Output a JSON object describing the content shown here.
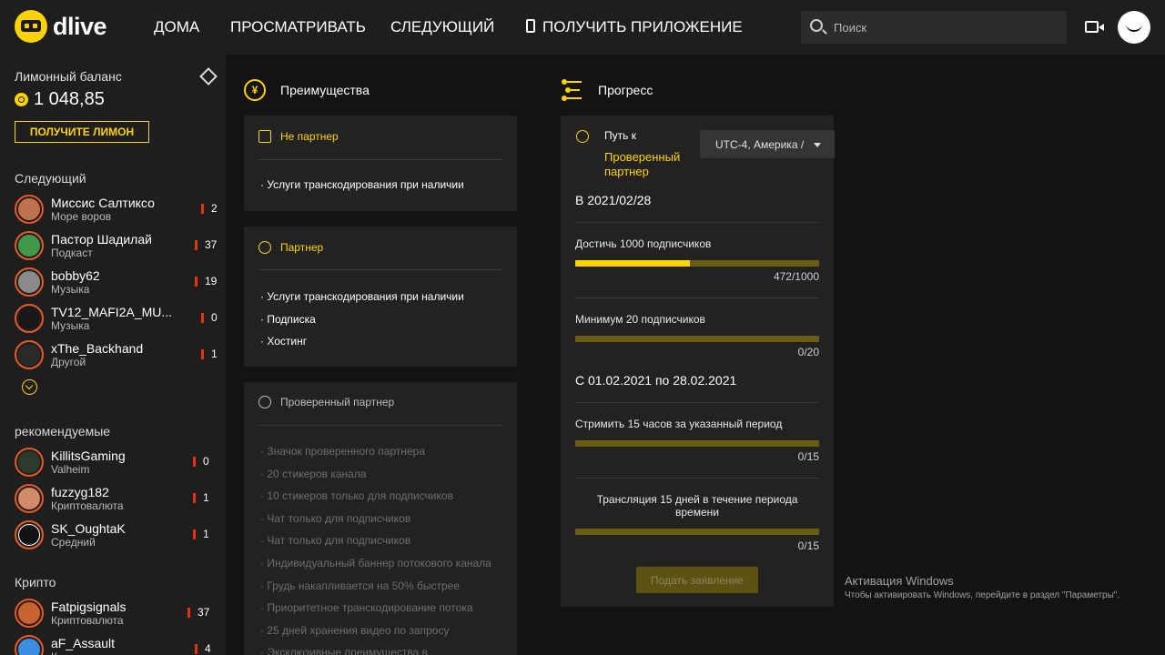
{
  "app": {
    "logo_text": "dlive"
  },
  "nav": {
    "home": "ДОМА",
    "browse": "ПРОСМАТРИВАТЬ",
    "following": "СЛЕДУЮЩИЙ",
    "get_app": "ПОЛУЧИТЬ ПРИЛОЖЕНИЕ"
  },
  "search": {
    "placeholder": "Поиск"
  },
  "sidebar": {
    "balance_title": "Лимонный баланс",
    "balance_value": "1 048,85",
    "get_lemon_label": "ПОЛУЧИТЕ ЛИМОН",
    "following_title": "Следующий",
    "following": [
      {
        "name": "Миссис Салтиксо",
        "category": "Море воров",
        "viewers": "2"
      },
      {
        "name": "Пастор Шадилай",
        "category": "Подкаст",
        "viewers": "37"
      },
      {
        "name": "bobby62",
        "category": "Музыка",
        "viewers": "19"
      },
      {
        "name": "TV12_MAFI2A_MU...",
        "category": "Музыка",
        "viewers": "0"
      },
      {
        "name": "xThe_Backhand",
        "category": "Другой",
        "viewers": "1"
      }
    ],
    "recommended_title": "рекомендуемые",
    "recommended": [
      {
        "name": "KillitsGaming",
        "category": "Valheim",
        "viewers": "0"
      },
      {
        "name": "fuzzyg182",
        "category": "Криптовалюта",
        "viewers": "1"
      },
      {
        "name": "SK_OughtaK",
        "category": "Средний",
        "viewers": "1"
      }
    ],
    "crypto_title": "Крипто",
    "crypto": [
      {
        "name": "Fatpigsignals",
        "category": "Криптовалюта",
        "viewers": "37"
      },
      {
        "name": "aF_Assault",
        "category": "К",
        "viewers": "4"
      }
    ]
  },
  "benefits": {
    "header": "Преимущества",
    "non_partner": {
      "title": "Не партнер",
      "items": [
        "· Услуги транскодирования при наличии"
      ]
    },
    "partner": {
      "title": "Партнер",
      "items": [
        "· Услуги транскодирования при наличии",
        "· Подписка",
        "· Хостинг"
      ]
    },
    "verified": {
      "title": "Проверенный партнер",
      "items": [
        "· Значок проверенного партнера",
        "· 20 стикеров канала",
        "· 10 стикеров только для подписчиков",
        "· Чат только для подписчиков",
        "· Чат только для подписчиков",
        "· Индивидуальный баннер потокового канала",
        "· Грудь накапливается на 50% быстрее",
        "· Приоритетное транскодирование потока",
        "· 25 дней хранения видео по запросу",
        "· Эксклюзивные преимущества в"
      ]
    }
  },
  "progress": {
    "header": "Прогресс",
    "path_to": "Путь к",
    "target_line1": "Проверенный",
    "target_line2": "партнер",
    "timezone": "UTC-4, Америка /",
    "as_of": "В 2021/02/28",
    "req1_label": "Достичь 1000 подписчиков",
    "req1_count": "472/1000",
    "req1_fraction": 0.472,
    "req2_label": "Минимум 20 подписчиков",
    "req2_count": "0/20",
    "req2_fraction": 0,
    "period": "С 01.02.2021 по 28.02.2021",
    "req3_label": "Стримить 15 часов за указанный период",
    "req3_count": "0/15",
    "req3_fraction": 0,
    "req4_label_line1": "Трансляция 15 дней в течение периода",
    "req4_label_line2": "времени",
    "req4_count": "0/15",
    "req4_fraction": 0,
    "apply_label": "Подать заявление"
  },
  "windows_activation": {
    "title": "Активация Windows",
    "subtitle": "Чтобы активировать Windows, перейдите в раздел \"Параметры\"."
  },
  "colors": {
    "accent": "#ffd300",
    "live": "#e8340c",
    "bg": "#131313",
    "panel": "#1e1e1e",
    "card": "#222222"
  }
}
